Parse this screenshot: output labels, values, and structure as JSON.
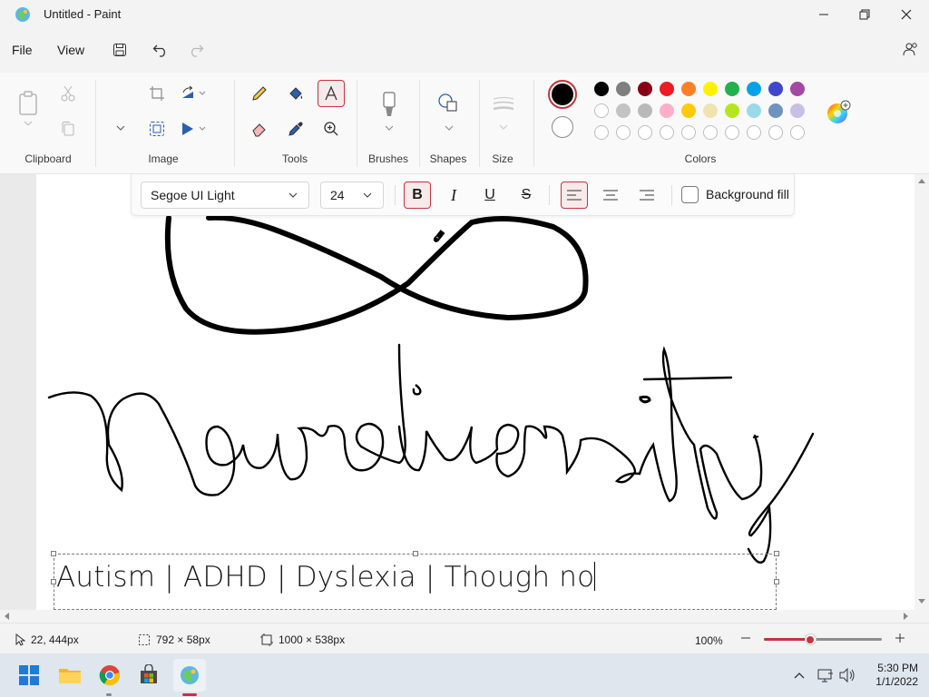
{
  "window": {
    "title": "Untitled - Paint"
  },
  "menu": {
    "file": "File",
    "view": "View"
  },
  "ribbon": {
    "groups": {
      "clipboard": "Clipboard",
      "image": "Image",
      "tools": "Tools",
      "brushes": "Brushes",
      "shapes": "Shapes",
      "size": "Size",
      "colors": "Colors"
    },
    "primary_color": "#000000",
    "secondary_color": "#ffffff",
    "palette_row1": [
      "#000000",
      "#7f7f7f",
      "#880015",
      "#ed1c24",
      "#ff7f27",
      "#fff200",
      "#22b14c",
      "#00a2e8",
      "#3f48cc",
      "#a349a4"
    ],
    "palette_row2": [
      "#ffffff",
      "#c3c3c3",
      "#b9b9b9",
      "#ffaec9",
      "#ffc90e",
      "#efe4b0",
      "#b5e61d",
      "#99d9ea",
      "#7092be",
      "#c8bfe7"
    ]
  },
  "text_toolbar": {
    "font": "Segoe UI Light",
    "size": "24",
    "bold": "B",
    "italic": "I",
    "underline": "U",
    "strike": "S",
    "background_fill": "Background fill"
  },
  "canvas": {
    "typed_text": "Autism | ADHD | Dyslexia | Though no"
  },
  "status": {
    "cursor": "22, 444px",
    "selection": "792 × 58px",
    "canvas_size": "1000 × 538px",
    "zoom": "100%",
    "zoom_fraction": 0.39
  },
  "taskbar": {
    "time": "5:30 PM",
    "date": "1/1/2022"
  }
}
